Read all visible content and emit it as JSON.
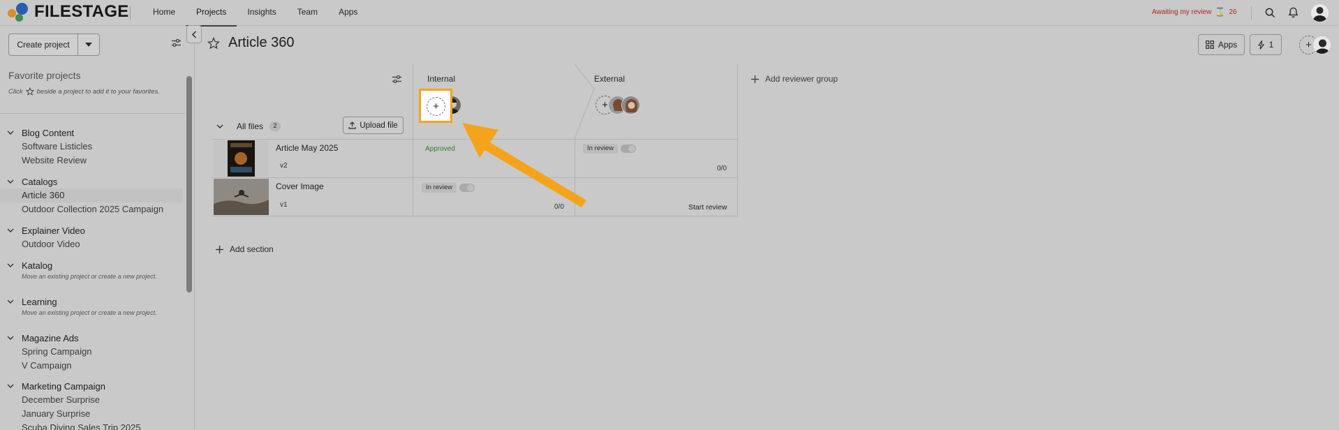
{
  "app": {
    "logo_text": "FILESTAGE",
    "nav": [
      "Home",
      "Projects",
      "Insights",
      "Team",
      "Apps"
    ],
    "active_nav": "Projects",
    "awaiting_label": "Awaiting my review",
    "awaiting_count": "26"
  },
  "sidebar": {
    "create_label": "Create project",
    "favorites_title": "Favorite projects",
    "favorites_hint_pre": "Click",
    "favorites_hint_post": "beside a project to add it to your favorites.",
    "groups": [
      {
        "name": "Blog Content",
        "projects": [
          "Software Listicles",
          "Website Review"
        ],
        "hint": ""
      },
      {
        "name": "Catalogs",
        "projects": [
          "Article 360",
          "Outdoor Collection 2025 Campaign"
        ],
        "hint": ""
      },
      {
        "name": "Explainer Video",
        "projects": [
          "Outdoor Video"
        ],
        "hint": ""
      },
      {
        "name": "Katalog",
        "projects": [],
        "hint": "Move an existing project or create a new project."
      },
      {
        "name": "Learning",
        "projects": [],
        "hint": "Move an existing project or create a new project."
      },
      {
        "name": "Magazine Ads",
        "projects": [
          "Spring Campaign",
          "V Campaign"
        ],
        "hint": ""
      },
      {
        "name": "Marketing Campaign",
        "projects": [
          "December Surprise",
          "January Surprise",
          "Scuba Diving Sales Trip 2025"
        ],
        "hint": ""
      }
    ],
    "selected_project": "Article 360"
  },
  "project": {
    "title": "Article 360",
    "apps_label": "Apps",
    "automations_count": "1",
    "reviewer_groups": [
      "Internal",
      "External"
    ],
    "add_reviewer_group": "Add reviewer group",
    "section": {
      "label": "All files",
      "count": "2",
      "upload_label": "Upload file"
    },
    "files": [
      {
        "name": "Article May 2025",
        "version": "v2",
        "internal_status": "Approved",
        "external_status": "In review",
        "external_count": "0/0"
      },
      {
        "name": "Cover Image",
        "version": "v1",
        "internal_status": "In review",
        "internal_count": "0/0",
        "external_action": "Start review"
      }
    ],
    "add_section": "Add section"
  },
  "colors": {
    "highlight": "#f5a31a",
    "approved": "#2e7d32",
    "awaiting": "#b02525"
  }
}
